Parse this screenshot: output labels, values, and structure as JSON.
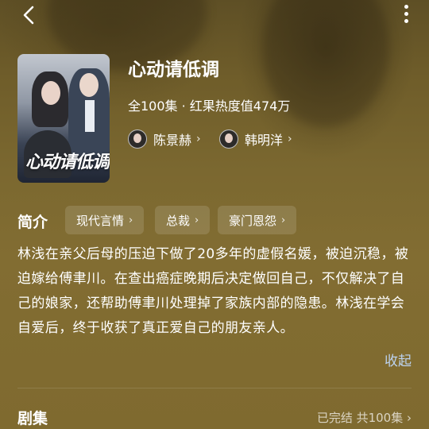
{
  "header": {
    "back_icon": "chevron-left-icon",
    "more_icon": "more-vertical-icon"
  },
  "drama": {
    "title": "心动请低调",
    "meta": "全100集 · 红果热度值474万",
    "poster_title": "心动请低调",
    "actors": [
      {
        "name": "陈景赫",
        "chevron": "›"
      },
      {
        "name": "韩明洋",
        "chevron": "›"
      }
    ]
  },
  "synopsis": {
    "section_label": "简介",
    "tags": [
      {
        "label": "现代言情",
        "chevron": "›"
      },
      {
        "label": "总裁",
        "chevron": "›"
      },
      {
        "label": "豪门恩怨",
        "chevron": "›"
      }
    ],
    "text": "林浅在亲父后母的压迫下做了20多年的虚假名媛，被迫沉稳，被迫嫁给傅聿川。在查出癌症晚期后决定做回自己，不仅解决了自己的娘家，还帮助傅聿川处理掉了家族内部的隐患。林浅在学会自爱后，终于收获了真正爱自己的朋友亲人。",
    "collapse_label": "收起"
  },
  "episodes": {
    "section_label": "剧集",
    "status": "已完结 共100集 ›"
  },
  "colors": {
    "background": "#7e6a2f",
    "link": "#bcd3f0"
  }
}
